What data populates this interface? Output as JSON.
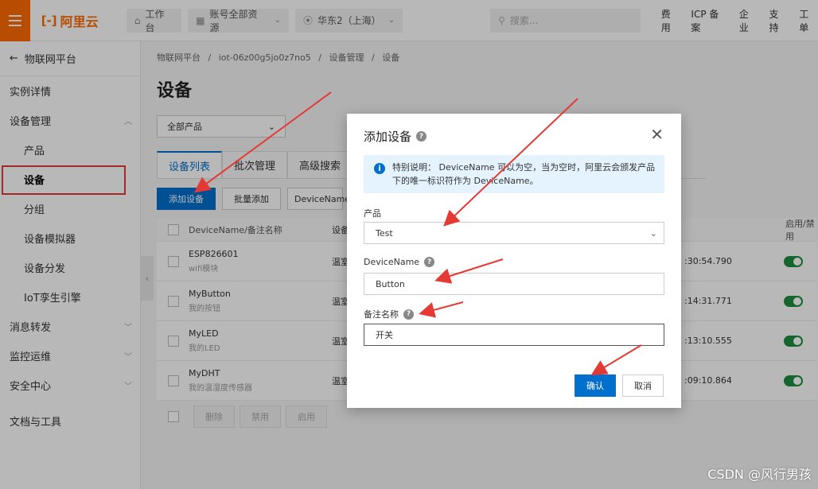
{
  "topbar": {
    "brand": "阿里云",
    "logo_mark": "[-]",
    "workbench": "工作台",
    "resources": "账号全部资源",
    "region": "华东2（上海）",
    "search_placeholder": "搜索...",
    "links": [
      "费用",
      "ICP 备案",
      "企业",
      "支持",
      "工单"
    ]
  },
  "sidebar": {
    "back_label": "物联网平台",
    "items": [
      {
        "label": "实例详情",
        "sub": false,
        "chevron": ""
      },
      {
        "label": "设备管理",
        "sub": false,
        "chevron": "up"
      },
      {
        "label": "产品",
        "sub": true,
        "chevron": ""
      },
      {
        "label": "设备",
        "sub": true,
        "chevron": "",
        "active": true
      },
      {
        "label": "分组",
        "sub": true,
        "chevron": ""
      },
      {
        "label": "设备模拟器",
        "sub": true,
        "chevron": ""
      },
      {
        "label": "设备分发",
        "sub": true,
        "chevron": ""
      },
      {
        "label": "IoT孪生引擎",
        "sub": true,
        "chevron": ""
      },
      {
        "label": "消息转发",
        "sub": false,
        "chevron": "down"
      },
      {
        "label": "监控运维",
        "sub": false,
        "chevron": "down"
      },
      {
        "label": "安全中心",
        "sub": false,
        "chevron": "down"
      },
      {
        "label": "文档与工具",
        "sub": false,
        "chevron": ""
      }
    ]
  },
  "main": {
    "breadcrumb": [
      "物联网平台",
      "/",
      "iot-06z00g5jo0z7no5",
      "/",
      "设备管理",
      "/",
      "设备"
    ],
    "title": "设备",
    "product_filter": "全部产品",
    "tabs": [
      "设备列表",
      "批次管理",
      "高级搜索"
    ],
    "toolbar": {
      "add": "添加设备",
      "batch_add": "批量添加",
      "filter": "DeviceName"
    },
    "table": {
      "header_name": "DeviceName/备注名称",
      "header_product": "设备",
      "header_enable": "启用/禁用",
      "rows": [
        {
          "name": "ESP826601",
          "note": "wifi模块",
          "product": "温室",
          "time": ":30:54.790"
        },
        {
          "name": "MyButton",
          "note": "我的按钮",
          "product": "温室",
          "time": ":14:31.771"
        },
        {
          "name": "MyLED",
          "note": "我的LED",
          "product": "温室",
          "time": ":13:10.555"
        },
        {
          "name": "MyDHT",
          "note": "我的温湿度传感器",
          "product": "温室",
          "time": ":09:10.864"
        }
      ]
    },
    "bulk": {
      "delete": "删除",
      "disable": "禁用",
      "enable": "启用"
    }
  },
  "dialog": {
    "title": "添加设备",
    "notice": "特别说明： DeviceName 可以为空，当为空时，阿里云会颁发产品下的唯一标识符作为 DeviceName。",
    "product_label": "产品",
    "product_value": "Test",
    "devicename_label": "DeviceName",
    "devicename_value": "Button",
    "note_label": "备注名称",
    "note_value": "开关",
    "confirm": "确认",
    "cancel": "取消"
  },
  "watermark": "CSDN @风行男孩",
  "colors": {
    "brand": "#ff6a00",
    "primary": "#0070cc",
    "annotation": "#e53935",
    "switch_on": "#1e8e3e"
  }
}
